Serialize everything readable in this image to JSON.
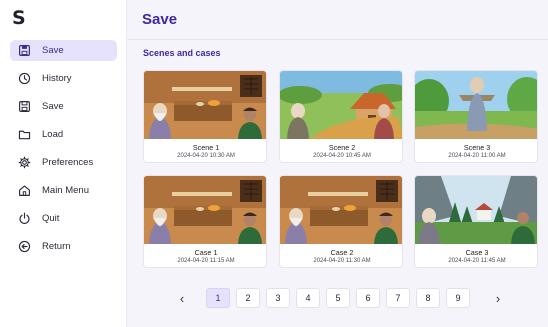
{
  "app": {
    "logo": "S"
  },
  "sidebar": {
    "items": [
      {
        "label": "Save",
        "icon": "save-icon",
        "active": true
      },
      {
        "label": "History",
        "icon": "clock-icon"
      },
      {
        "label": "Save",
        "icon": "save-icon"
      },
      {
        "label": "Load",
        "icon": "folder-icon"
      },
      {
        "label": "Preferences",
        "icon": "gear-icon"
      },
      {
        "label": "Main Menu",
        "icon": "home-icon"
      },
      {
        "label": "Quit",
        "icon": "power-icon"
      },
      {
        "label": "Return",
        "icon": "back-arrow-icon"
      }
    ]
  },
  "main": {
    "title": "Save",
    "section_title": "Scenes and cases",
    "cards": [
      {
        "name": "Scene 1",
        "date": "2024-04-20 10:30 AM",
        "thumb": "interior"
      },
      {
        "name": "Scene 2",
        "date": "2024-04-20 10:45 AM",
        "thumb": "village"
      },
      {
        "name": "Scene 3",
        "date": "2024-04-20 11:00 AM",
        "thumb": "outdoor"
      },
      {
        "name": "Case 1",
        "date": "2024-04-20 11:15 AM",
        "thumb": "interior"
      },
      {
        "name": "Case 2",
        "date": "2024-04-20 11:30 AM",
        "thumb": "interior"
      },
      {
        "name": "Case 3",
        "date": "2024-04-20 11:45 AM",
        "thumb": "valley"
      }
    ]
  },
  "pagination": {
    "prev": "‹",
    "next": "›",
    "pages": [
      "1",
      "2",
      "3",
      "4",
      "5",
      "6",
      "7",
      "8",
      "9"
    ],
    "current": "1"
  },
  "colors": {
    "accent": "#3b2aa3",
    "active_bg": "#e6e2fb"
  }
}
